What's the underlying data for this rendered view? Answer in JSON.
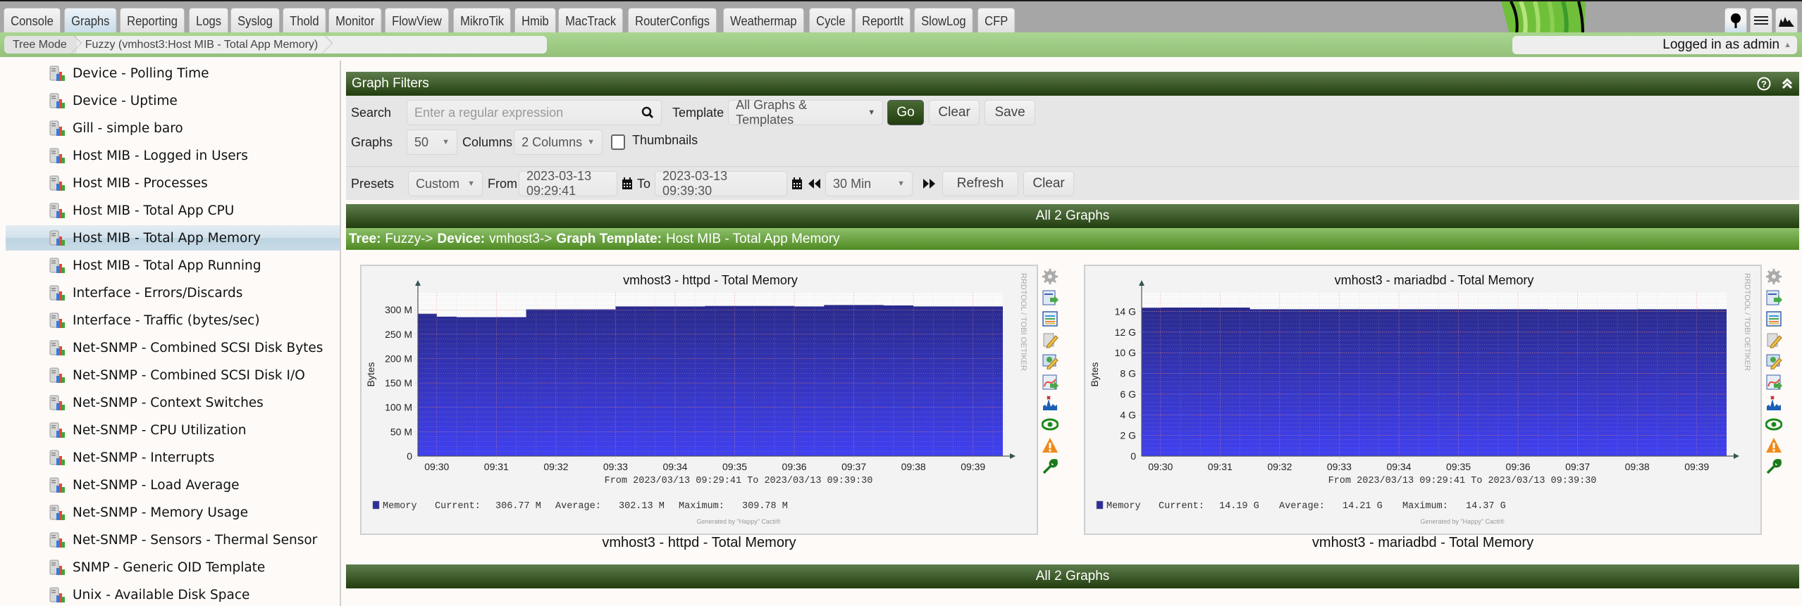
{
  "topnav": {
    "tabs": [
      {
        "label": "Console"
      },
      {
        "label": "Graphs",
        "active": true
      },
      {
        "label": "Reporting"
      },
      {
        "label": "Logs"
      },
      {
        "label": "Syslog"
      },
      {
        "label": "Thold"
      },
      {
        "label": "Monitor"
      },
      {
        "label": "FlowView"
      },
      {
        "label": "MikroTik"
      },
      {
        "label": "Hmib"
      },
      {
        "label": "MacTrack"
      },
      {
        "label": "RouterConfigs"
      },
      {
        "label": "Weathermap"
      },
      {
        "label": "Cycle"
      },
      {
        "label": "ReportIt"
      },
      {
        "label": "SlowLog"
      },
      {
        "label": "CFP"
      }
    ],
    "view_modes": [
      "tree-view-icon",
      "list-view-icon",
      "preview-view-icon"
    ]
  },
  "breadcrumb": {
    "items": [
      "Tree Mode",
      "Fuzzy (vmhost3:Host MIB - Total App Memory)"
    ]
  },
  "user": {
    "label": "Logged in as admin"
  },
  "sidebar": {
    "items": [
      {
        "label": "Device - Polling Time"
      },
      {
        "label": "Device - Uptime"
      },
      {
        "label": "Gill - simple baro"
      },
      {
        "label": "Host MIB - Logged in Users"
      },
      {
        "label": "Host MIB - Processes"
      },
      {
        "label": "Host MIB - Total App CPU"
      },
      {
        "label": "Host MIB - Total App Memory",
        "selected": true
      },
      {
        "label": "Host MIB - Total App Running"
      },
      {
        "label": "Interface - Errors/Discards"
      },
      {
        "label": "Interface - Traffic (bytes/sec)"
      },
      {
        "label": "Net-SNMP - Combined SCSI Disk Bytes"
      },
      {
        "label": "Net-SNMP - Combined SCSI Disk I/O"
      },
      {
        "label": "Net-SNMP - Context Switches"
      },
      {
        "label": "Net-SNMP - CPU Utilization"
      },
      {
        "label": "Net-SNMP - Interrupts"
      },
      {
        "label": "Net-SNMP - Load Average"
      },
      {
        "label": "Net-SNMP - Memory Usage"
      },
      {
        "label": "Net-SNMP - Sensors - Thermal Sensor"
      },
      {
        "label": "SNMP - Generic OID Template"
      },
      {
        "label": "Unix - Available Disk Space"
      }
    ]
  },
  "filters": {
    "title": "Graph Filters",
    "search_label": "Search",
    "search_placeholder": "Enter a regular expression",
    "search_value": "",
    "template_label": "Template",
    "template_value": "All Graphs & Templates",
    "go_label": "Go",
    "clear_label": "Clear",
    "save_label": "Save",
    "graphs_label": "Graphs",
    "graphs_value": "50",
    "columns_label": "Columns",
    "columns_value": "2 Columns",
    "thumbnails_label": "Thumbnails",
    "thumbnails_checked": false,
    "presets_label": "Presets",
    "presets_value": "Custom",
    "from_label": "From",
    "from_value": "2023-03-13 09:29:41",
    "to_label": "To",
    "to_value": "2023-03-13 09:39:30",
    "timespan_value": "30 Min",
    "refresh_label": "Refresh",
    "clear2_label": "Clear"
  },
  "results": {
    "header": "All 2 Graphs",
    "footer": "All 2 Graphs",
    "tree_line": {
      "tree_label": "Tree:",
      "tree_value": "Fuzzy->",
      "device_label": "Device:",
      "device_value": "vmhost3->",
      "template_label": "Graph Template:",
      "template_value": "Host MIB - Total App Memory"
    }
  },
  "chart_data": [
    {
      "type": "area",
      "title": "vmhost3 - httpd - Total Memory",
      "caption": "vmhost3 - httpd - Total Memory",
      "ylabel": "Bytes",
      "xlabel": "",
      "x": [
        "09:29:41",
        "09:30",
        "09:30:20",
        "09:31",
        "09:31:30",
        "09:32",
        "09:33",
        "09:34",
        "09:34:30",
        "09:35",
        "09:35:30",
        "09:36",
        "09:36:30",
        "09:37",
        "09:37:30",
        "09:38",
        "09:39",
        "09:39:30"
      ],
      "values_M": [
        292,
        286,
        285,
        285,
        301,
        301,
        307,
        307,
        308,
        308,
        308,
        307,
        310,
        310,
        309,
        307,
        307,
        307
      ],
      "yticks": [
        "0",
        "50 M",
        "100 M",
        "150 M",
        "200 M",
        "250 M",
        "300 M"
      ],
      "ytick_values_M": [
        0,
        50,
        100,
        150,
        200,
        250,
        300
      ],
      "ylim_M": [
        0,
        335
      ],
      "xticks": [
        "09:30",
        "09:31",
        "09:32",
        "09:33",
        "09:34",
        "09:35",
        "09:36",
        "09:37",
        "09:38",
        "09:39"
      ],
      "range_text": "From 2023/03/13 09:29:41 To 2023/03/13 09:39:30",
      "legend": {
        "name": "Memory",
        "current_label": "Current:",
        "current": "306.77 M",
        "average_label": "Average:",
        "average": "302.13 M",
        "maximum_label": "Maximum:",
        "maximum": "309.78 M"
      },
      "credit": "Generated by \"Happy\" Cacti®",
      "watermark": "RRDTOOL / TOBI OETIKER",
      "grid": true,
      "color": "#2b2f9c"
    },
    {
      "type": "area",
      "title": "vmhost3 - mariadbd - Total Memory",
      "caption": "vmhost3 - mariadbd - Total Memory",
      "ylabel": "Bytes",
      "xlabel": "",
      "x": [
        "09:29:41",
        "09:30",
        "09:31",
        "09:31:30",
        "09:32",
        "09:33",
        "09:34",
        "09:35",
        "09:36",
        "09:36:30",
        "09:37",
        "09:38",
        "09:39",
        "09:39:30"
      ],
      "values_G": [
        14.35,
        14.37,
        14.37,
        14.21,
        14.21,
        14.21,
        14.21,
        14.21,
        14.21,
        14.19,
        14.19,
        14.21,
        14.21,
        14.19
      ],
      "yticks": [
        "0",
        "2 G",
        "4 G",
        "6 G",
        "8 G",
        "10 G",
        "12 G",
        "14 G"
      ],
      "ytick_values_G": [
        0,
        2,
        4,
        6,
        8,
        10,
        12,
        14
      ],
      "ylim_G": [
        0,
        15.8
      ],
      "xticks": [
        "09:30",
        "09:31",
        "09:32",
        "09:33",
        "09:34",
        "09:35",
        "09:36",
        "09:37",
        "09:38",
        "09:39"
      ],
      "range_text": "From 2023/03/13 09:29:41 To 2023/03/13 09:39:30",
      "legend": {
        "name": "Memory",
        "current_label": "Current:",
        "current": "14.19 G",
        "average_label": "Average:",
        "average": "14.21 G",
        "maximum_label": "Maximum:",
        "maximum": "14.37 G"
      },
      "credit": "Generated by \"Happy\" Cacti®",
      "watermark": "RRDTOOL / TOBI OETIKER",
      "grid": true,
      "color": "#2b2f9c"
    }
  ],
  "graph_actions": [
    "settings-gear-icon",
    "export-csv-icon",
    "graph-legend-icon",
    "edit-graph-icon",
    "edit-device-icon",
    "zoom-graph-icon",
    "spike-kill-icon",
    "realtime-view-icon",
    "threshold-alert-icon",
    "tools-wrench-icon"
  ]
}
